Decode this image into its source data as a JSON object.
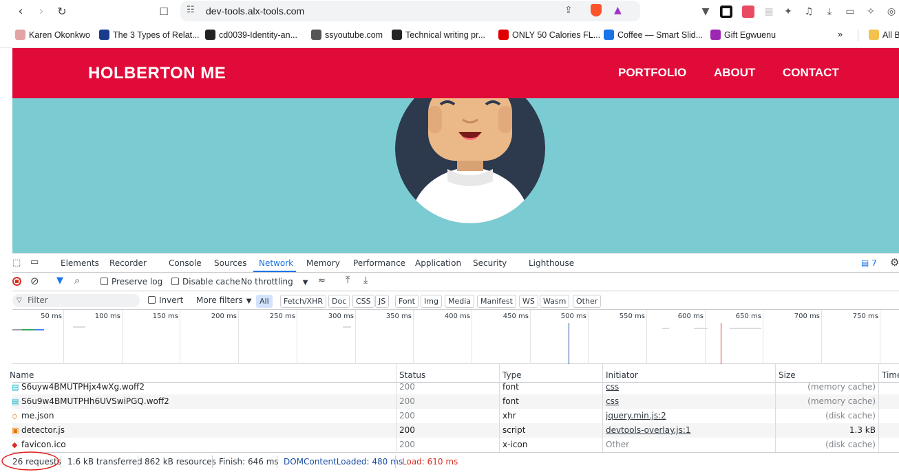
{
  "browser": {
    "url": "dev-tools.alx-tools.com",
    "bookmarks": [
      {
        "label": "Karen Okonkwo",
        "icon": "karen-icon",
        "color": "#e2a4a4"
      },
      {
        "label": "The 3 Types of Relat...",
        "icon": "grid-icon",
        "color": "#1a3a8c"
      },
      {
        "label": "cd0039-Identity-an...",
        "icon": "github-icon",
        "color": "#222222"
      },
      {
        "label": "ssyoutube.com",
        "icon": "globe-icon",
        "color": "#555555"
      },
      {
        "label": "Technical writing pr...",
        "icon": "github-icon",
        "color": "#222222"
      },
      {
        "label": "ONLY 50 Calories FL...",
        "icon": "youtube-icon",
        "color": "#e10000"
      },
      {
        "label": "Coffee — Smart Slid...",
        "icon": "coffee-icon",
        "color": "#1a73e8"
      },
      {
        "label": "Gift Egwuenu",
        "icon": "gift-icon",
        "color": "#9c27b0"
      }
    ],
    "overflow": "»",
    "all_bookmarks": "All B"
  },
  "site": {
    "logo": "HOLBERTON ME",
    "nav": [
      "PORTFOLIO",
      "ABOUT",
      "CONTACT"
    ],
    "header_color": "#e10b39",
    "hero_color": "#7accd2"
  },
  "devtools": {
    "tabs": [
      "Elements",
      "Recorder",
      "Console",
      "Sources",
      "Network",
      "Memory",
      "Performance",
      "Application",
      "Security",
      "Lighthouse"
    ],
    "active_tab": "Network",
    "issues_count": "7",
    "toolbar": {
      "preserve_log": "Preserve log",
      "disable_cache": "Disable cache",
      "throttling": "No throttling"
    },
    "filterbar": {
      "placeholder": "Filter",
      "invert": "Invert",
      "more_filters": "More filters",
      "chips": [
        "All",
        "Fetch/XHR",
        "Doc",
        "CSS",
        "JS",
        "Font",
        "Img",
        "Media",
        "Manifest",
        "WS",
        "Wasm",
        "Other"
      ],
      "active_chip": "All"
    },
    "timeline_ticks": [
      "50 ms",
      "100 ms",
      "150 ms",
      "200 ms",
      "250 ms",
      "300 ms",
      "350 ms",
      "400 ms",
      "450 ms",
      "500 ms",
      "550 ms",
      "600 ms",
      "650 ms",
      "700 ms",
      "750 ms"
    ],
    "columns": [
      "Name",
      "Status",
      "Type",
      "Initiator",
      "Size",
      "Time"
    ],
    "rows": [
      {
        "name": "S6uyw4BMUTPHjx4wXg.woff2",
        "status": "200",
        "type": "font",
        "initiator": "css",
        "size": "(memory cache)",
        "icon": "font-file-icon"
      },
      {
        "name": "S6u9w4BMUTPHh6UVSwiPGQ.woff2",
        "status": "200",
        "type": "font",
        "initiator": "css",
        "size": "(memory cache)",
        "icon": "font-file-icon"
      },
      {
        "name": "me.json",
        "status": "200",
        "type": "xhr",
        "initiator": "jquery.min.js:2",
        "size": "(disk cache)",
        "icon": "json-file-icon"
      },
      {
        "name": "detector.js",
        "status": "200",
        "type": "script",
        "initiator": "devtools-overlay.js:1",
        "size": "1.3 kB",
        "icon": "script-file-icon"
      },
      {
        "name": "favicon.ico",
        "status": "200",
        "type": "x-icon",
        "initiator": "Other",
        "size": "(disk cache)",
        "icon": "image-file-icon"
      }
    ],
    "status": {
      "requests": "26 requests",
      "transferred": "1.6 kB transferred",
      "resources": "862 kB resources",
      "finish": "Finish: 646 ms",
      "dom_loaded": "DOMContentLoaded: 480 ms",
      "load": "Load: 610 ms"
    }
  }
}
